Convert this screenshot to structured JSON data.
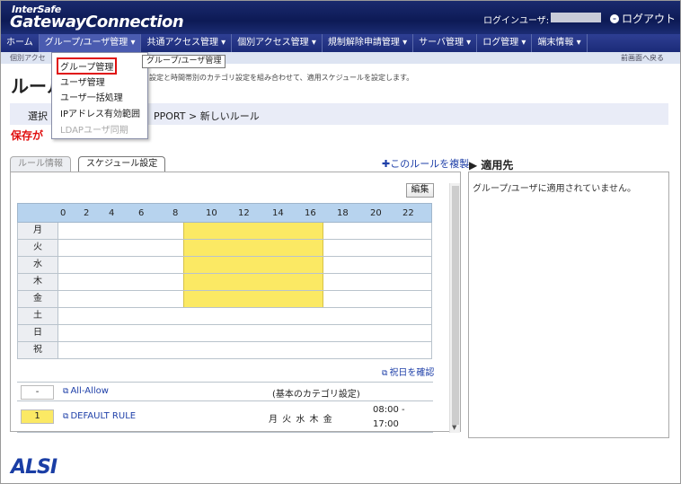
{
  "header": {
    "logo_top": "InterSafe",
    "logo_bottom": "GatewayConnection",
    "login_label": "ログインユーザ:",
    "logout": "ログアウト"
  },
  "menu": [
    "ホーム",
    "グループ/ユーザ管理 ▾",
    "共通アクセス管理 ▾",
    "個別アクセス管理 ▾",
    "規制解除申請管理 ▾",
    "サーバ管理 ▾",
    "ログ管理 ▾",
    "端末情報 ▾"
  ],
  "substrip": {
    "crumb": "個別アクセ",
    "back": "前画面へ戻る"
  },
  "dropdown": {
    "items": [
      "グループ管理",
      "ユーザ管理",
      "ユーザ一括処理",
      "IPアドレス有効範囲",
      "LDAPユーザ同期"
    ]
  },
  "tooltip": "グループ/ユーザ管理",
  "page": {
    "title": "ルール",
    "description": "設定と時間帯別のカテゴリ設定を組み合わせて、適用スケジュールを設定します。",
    "select_label": "選択",
    "select_path": "PPORT > 新しいルール",
    "warning": "保存が"
  },
  "tabs": {
    "rule_info": "ルール情報",
    "schedule": "スケジュール設定"
  },
  "copy_rule": "✚このルールを複製",
  "apply_to": {
    "title": "▶ 適用先",
    "message": "グループ/ユーザに適用されていません。"
  },
  "edit_button": "編集",
  "schedule": {
    "hours": [
      "0",
      "2",
      "4",
      "6",
      "8",
      "10",
      "12",
      "14",
      "16",
      "18",
      "20",
      "22"
    ],
    "days": [
      {
        "label": "月",
        "active": true
      },
      {
        "label": "火",
        "active": true
      },
      {
        "label": "水",
        "active": true
      },
      {
        "label": "木",
        "active": true
      },
      {
        "label": "金",
        "active": true
      },
      {
        "label": "土",
        "active": false
      },
      {
        "label": "日",
        "active": false
      },
      {
        "label": "祝",
        "active": false
      }
    ],
    "active_start_hour": 8,
    "active_end_hour": 17,
    "fill_color": "#fbe964"
  },
  "holiday_link": "祝日を確認",
  "rules": [
    {
      "number": "-",
      "name": "All-Allow",
      "detail": "(基本のカテゴリ設定)",
      "time_from": "",
      "time_to": ""
    },
    {
      "number": "1",
      "name": "DEFAULT RULE",
      "detail": "月 火 水 木 金",
      "time_from": "08:00 -",
      "time_to": "17:00"
    }
  ],
  "footer_logo": "ALSI"
}
